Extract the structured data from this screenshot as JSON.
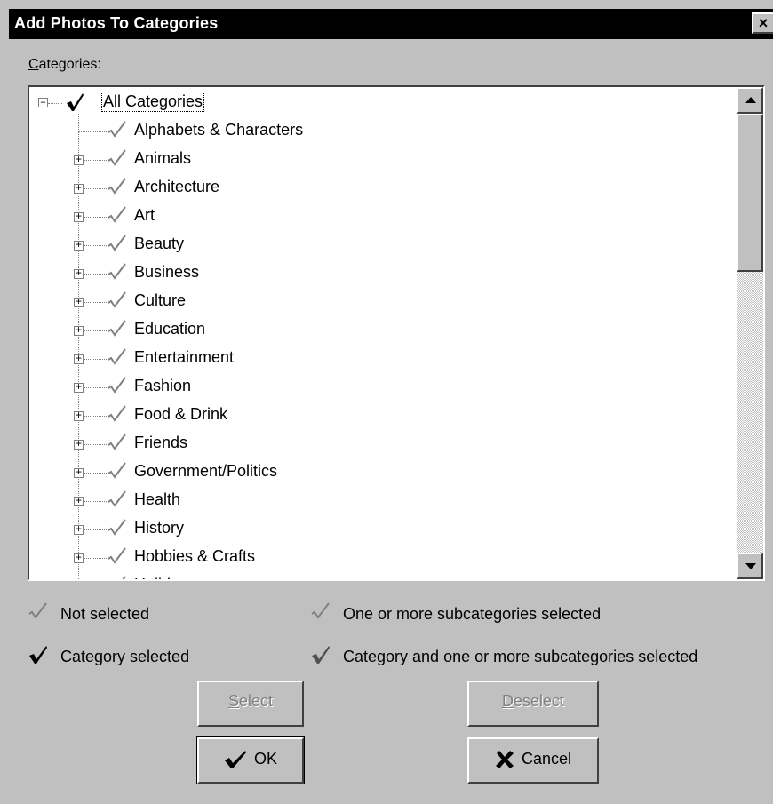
{
  "window": {
    "title": "Add Photos To Categories",
    "close_label": "×"
  },
  "categories_label_first": "C",
  "categories_label_rest": "ategories:",
  "tree": {
    "root": "All Categories",
    "items": [
      "Alphabets & Characters",
      "Animals",
      "Architecture",
      "Art",
      "Beauty",
      "Business",
      "Culture",
      "Education",
      "Entertainment",
      "Fashion",
      "Food & Drink",
      "Friends",
      "Government/Politics",
      "Health",
      "History",
      "Hobbies & Crafts",
      "Holidays"
    ]
  },
  "legend": {
    "not_selected": "Not selected",
    "subcats_selected": "One or more subcategories selected",
    "category_selected": "Category selected",
    "category_and_subcats": "Category and one or more subcategories selected"
  },
  "buttons": {
    "select_first": "S",
    "select_rest": "elect",
    "deselect_first": "D",
    "deselect_rest": "eselect",
    "ok": "OK",
    "cancel": "Cancel"
  },
  "icons": {
    "check_light": "check-light-icon",
    "check_dark": "check-dark-icon",
    "cancel": "x-icon"
  }
}
